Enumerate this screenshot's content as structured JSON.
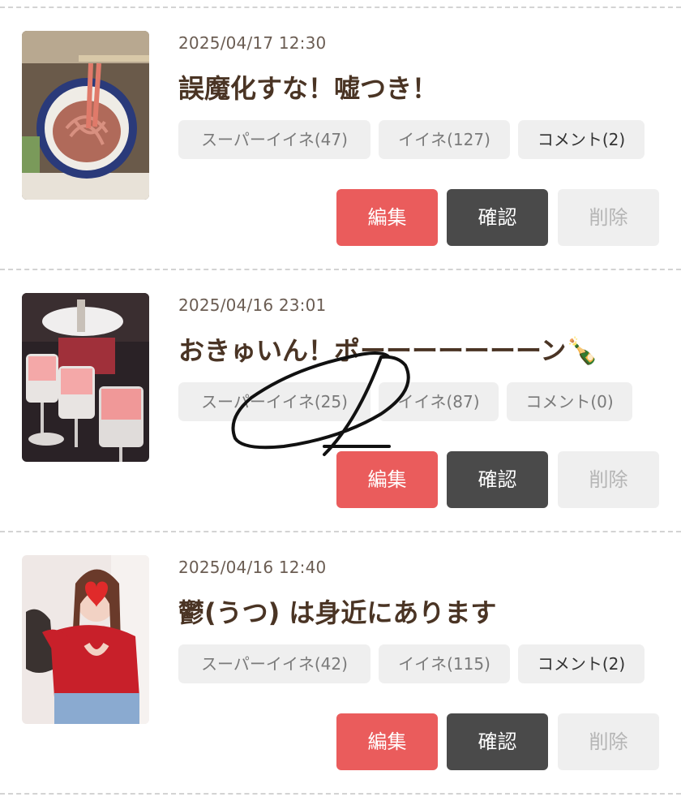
{
  "posts": [
    {
      "date": "2025/04/17 12:30",
      "title": "誤魔化すな！嘘つき！",
      "super_like": "スーパーイイネ(47)",
      "like": "イイネ(127)",
      "comment": "コメント(2)",
      "thumbnail": "noodle-dish-photo"
    },
    {
      "date": "2025/04/16 23:01",
      "title": "おきゅいん！ポーーーーーーーン🍾",
      "super_like": "スーパーイイネ(25)",
      "like": "イイネ(87)",
      "comment": "コメント(0)",
      "thumbnail": "champagne-glasses-photo"
    },
    {
      "date": "2025/04/16 12:40",
      "title": "鬱(うつ) は身近にあります",
      "super_like": "スーパーイイネ(42)",
      "like": "イイネ(115)",
      "comment": "コメント(2)",
      "thumbnail": "woman-red-sweater-photo"
    }
  ],
  "buttons": {
    "edit": "編集",
    "confirm": "確認",
    "delete": "削除"
  },
  "colors": {
    "edit": "#ea5c5c",
    "confirm": "#4a4a4a",
    "delete_bg": "#efefef",
    "chip_bg": "#efefef",
    "title": "#4a3424"
  }
}
